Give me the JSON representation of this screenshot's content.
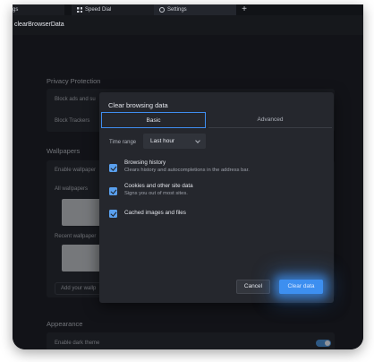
{
  "tabs": [
    {
      "label": "gs"
    },
    {
      "label": "Speed Dial",
      "icon": "speed-dial-icon"
    },
    {
      "label": "Settings",
      "icon": "gear-icon"
    }
  ],
  "new_tab_glyph": "+",
  "address_bar": {
    "text": "clearBrowserData"
  },
  "settings": {
    "privacy": {
      "title": "Privacy Protection",
      "rows": [
        "Block ads and su",
        "Block Trackers"
      ]
    },
    "wallpapers": {
      "title": "Wallpapers",
      "enable_label": "Enable wallpaper",
      "all_label": "All wallpapers",
      "recent_label": "Recent wallpaper",
      "add_label": "Add your wallp"
    },
    "appearance": {
      "title": "Appearance",
      "dark_theme_label": "Enable dark theme"
    }
  },
  "dialog": {
    "title": "Clear browsing data",
    "tabs": {
      "basic": "Basic",
      "advanced": "Advanced"
    },
    "time_range_label": "Time range",
    "time_range_value": "Last hour",
    "options": [
      {
        "title": "Browsing history",
        "desc": "Clears history and autocompletions in the address bar.",
        "checked": true
      },
      {
        "title": "Cookies and other site data",
        "desc": "Signs you out of most sites.",
        "checked": true
      },
      {
        "title": "Cached images and files",
        "desc": "",
        "checked": true
      }
    ],
    "cancel_label": "Cancel",
    "clear_label": "Clear data"
  },
  "colors": {
    "accent": "#3d8ff0",
    "background": "#1e2027",
    "dialog": "#25272d"
  }
}
